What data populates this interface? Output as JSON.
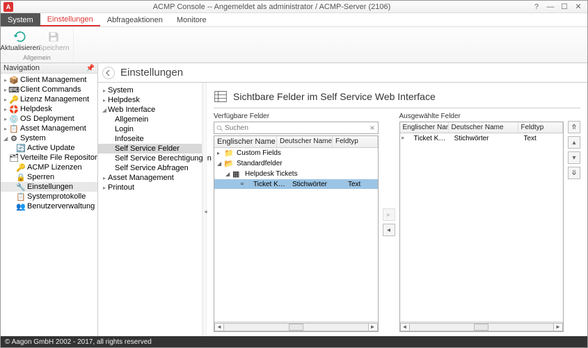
{
  "title": "ACMP Console -- Angemeldet als administrator / ACMP-Server (2106)",
  "appIconLetter": "A",
  "menubar": {
    "system": "System",
    "einstellungen": "Einstellungen",
    "abfrageaktionen": "Abfrageaktionen",
    "monitore": "Monitore"
  },
  "ribbon": {
    "aktualisieren": "Aktualisieren",
    "speichern": "Speichern",
    "group_allgemein": "Allgemein"
  },
  "nav": {
    "header": "Navigation",
    "items": [
      {
        "label": "Client Management"
      },
      {
        "label": "Client Commands"
      },
      {
        "label": "Lizenz Management"
      },
      {
        "label": "Helpdesk"
      },
      {
        "label": "OS Deployment"
      },
      {
        "label": "Asset Management"
      },
      {
        "label": "System",
        "expanded": true,
        "children": [
          {
            "label": "Active Update"
          },
          {
            "label": "Verteilte File Repositories"
          },
          {
            "label": "ACMP Lizenzen"
          },
          {
            "label": "Sperren"
          },
          {
            "label": "Einstellungen",
            "selected": true
          },
          {
            "label": "Systemprotokolle"
          },
          {
            "label": "Benutzerverwaltung"
          }
        ]
      }
    ]
  },
  "settings": {
    "title": "Einstellungen",
    "tree": [
      {
        "label": "System"
      },
      {
        "label": "Helpdesk"
      },
      {
        "label": "Web Interface",
        "expanded": true,
        "children": [
          {
            "label": "Allgemein"
          },
          {
            "label": "Login"
          },
          {
            "label": "Infoseite"
          },
          {
            "label": "Self Service Felder",
            "selected": true
          },
          {
            "label": "Self Service Berechtigungen"
          },
          {
            "label": "Self Service Abfragen"
          }
        ]
      },
      {
        "label": "Asset Management"
      },
      {
        "label": "Printout"
      }
    ]
  },
  "mainPane": {
    "heading": "Sichtbare Felder im Self Service Web Interface",
    "available_label": "Verfügbare Felder",
    "selected_label": "Ausgewählte Felder",
    "search_placeholder": "Suchen",
    "col_en": "Englischer Name",
    "col_de": "Deutscher Name",
    "col_type": "Feldtyp",
    "availableTree": {
      "customFields": "Custom Fields",
      "standardFields": "Standardfelder",
      "helpdeskTickets": "Helpdesk Tickets",
      "row": {
        "en": "Ticket Key...",
        "de": "Stichwörter",
        "type": "Text"
      }
    },
    "selectedRows": [
      {
        "en": "Ticket Keyw...",
        "de": "Stichwörter",
        "type": "Text"
      }
    ]
  },
  "statusbar": "© Aagon GmbH 2002 - 2017, all rights reserved",
  "icons": {
    "fold": "📁",
    "foldOpen": "📂",
    "page": "📄",
    "gear": "⚙",
    "lock": "🔒",
    "key": "🔑",
    "users": "👥",
    "refresh": "↻"
  }
}
